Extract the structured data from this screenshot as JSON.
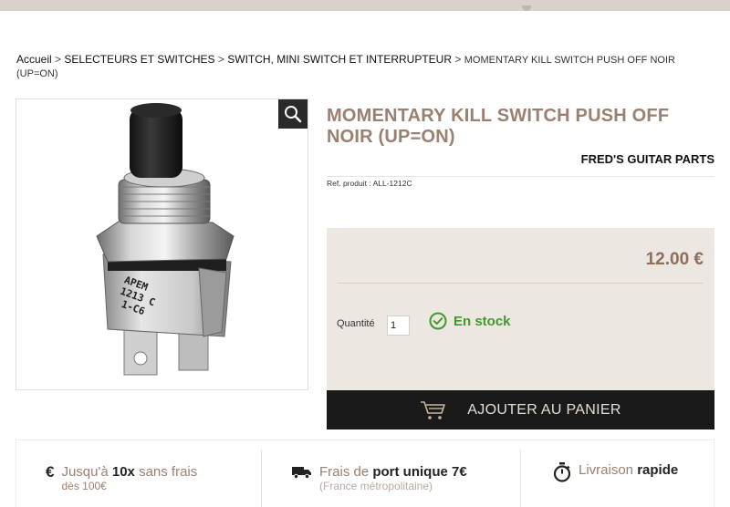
{
  "breadcrumb": {
    "home": "Accueil",
    "sep": ">",
    "category": "SELECTEURS ET SWITCHES",
    "subcategory": "SWITCH, MINI SWITCH ET INTERRUPTEUR",
    "current": "MOMENTARY KILL SWITCH PUSH OFF NOIR (UP=ON)"
  },
  "product": {
    "image_alt": "APEM 1213 C 1-C6",
    "title": "MOMENTARY KILL SWITCH PUSH OFF NOIR (UP=ON)",
    "brand": "FRED'S GUITAR PARTS",
    "ref_label": "Ref. produit :",
    "ref_value": "ALL-1212C"
  },
  "purchase": {
    "price": "12.00 €",
    "qty_label": "Quantité",
    "qty_value": "1",
    "stock_status": "En stock",
    "add_to_cart": "AJOUTER AU PANIER"
  },
  "features": [
    {
      "icon": "euro-icon",
      "prefix": "Jusqu'à ",
      "bold": "10x",
      "suffix": " sans frais",
      "sub": "dès 100€"
    },
    {
      "icon": "truck-icon",
      "prefix": "Frais de ",
      "bold": "port unique 7€",
      "suffix": "",
      "sub": "(France métropolitaine)"
    },
    {
      "icon": "stopwatch-icon",
      "prefix": "Livraison ",
      "bold": "rapide",
      "suffix": "",
      "sub": ""
    }
  ],
  "colors": {
    "accent": "#9a8070",
    "buy_box_bg": "#ede7e2",
    "cart_button_bg": "#1a1a1a",
    "stock_green": "#3e9a2e"
  }
}
